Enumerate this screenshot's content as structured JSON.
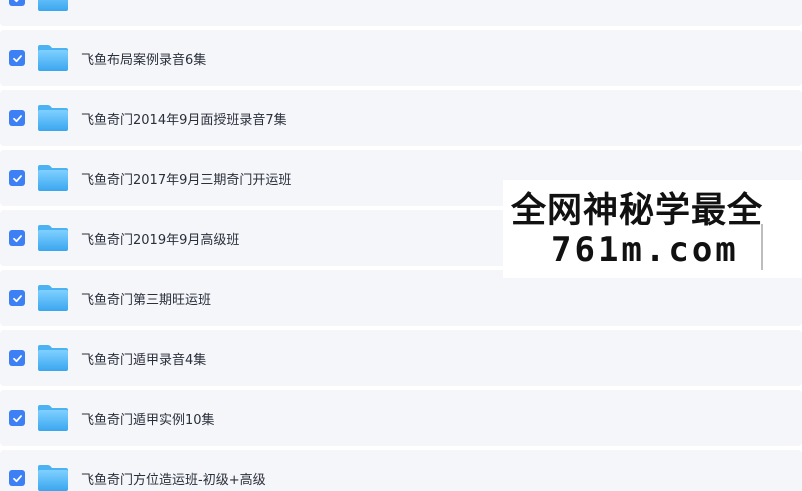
{
  "colors": {
    "row_background": "#f5f6fa",
    "checkbox_accent": "#3d7ff5",
    "folder_color": "#5ab8f5",
    "text_color": "#2a2f3a"
  },
  "files": [
    {
      "name": "",
      "checked": true,
      "icon": "folder-icon"
    },
    {
      "name": "飞鱼布局案例录音6集",
      "checked": true,
      "icon": "folder-icon"
    },
    {
      "name": "飞鱼奇门2014年9月面授班录音7集",
      "checked": true,
      "icon": "folder-icon"
    },
    {
      "name": "飞鱼奇门2017年9月三期奇门开运班",
      "checked": true,
      "icon": "folder-icon"
    },
    {
      "name": "飞鱼奇门2019年9月高级班",
      "checked": true,
      "icon": "folder-icon"
    },
    {
      "name": "飞鱼奇门第三期旺运班",
      "checked": true,
      "icon": "folder-icon"
    },
    {
      "name": "飞鱼奇门遁甲录音4集",
      "checked": true,
      "icon": "folder-icon"
    },
    {
      "name": "飞鱼奇门遁甲实例10集",
      "checked": true,
      "icon": "folder-icon"
    },
    {
      "name": "飞鱼奇门方位造运班-初级+高级",
      "checked": true,
      "icon": "folder-icon"
    }
  ],
  "watermark": {
    "line1": "全网神秘学最全",
    "line2": "761m.com"
  }
}
